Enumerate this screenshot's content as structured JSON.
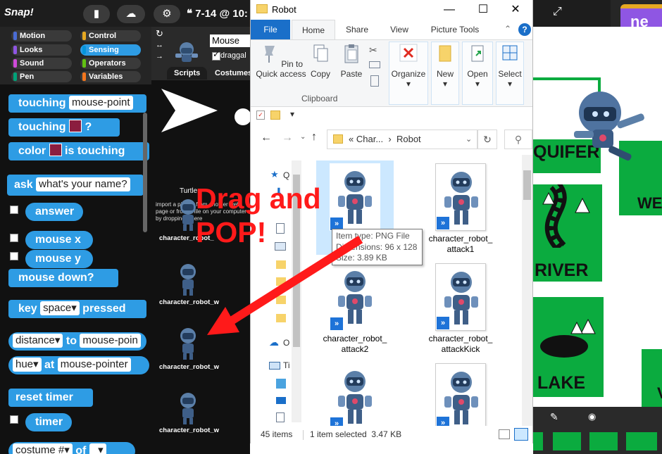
{
  "snap": {
    "logo": "Snap!",
    "project_title": "7-14 @ 10:",
    "categories": [
      {
        "label": "Motion",
        "color": "#4a6cd4"
      },
      {
        "label": "Looks",
        "color": "#8f56e3"
      },
      {
        "label": "Sound",
        "color": "#cf4ad9"
      },
      {
        "label": "Pen",
        "color": "#00a178"
      },
      {
        "label": "Control",
        "color": "#e6a822"
      },
      {
        "label": "Sensing",
        "color": "#0494dc"
      },
      {
        "label": "Operators",
        "color": "#62c213"
      },
      {
        "label": "Variables",
        "color": "#f3761d"
      }
    ],
    "blocks": {
      "touching_label": "touching",
      "touching_mouse_value": "mouse-point",
      "touching_color_label": "touching",
      "touching_color_q": "?",
      "color_label": "color",
      "is_touching_label": "is touching",
      "ask_label": "ask",
      "ask_default": "what's your name?",
      "answer": "answer",
      "mouse_x": "mouse x",
      "mouse_y": "mouse y",
      "mouse_down": "mouse down?",
      "key_label": "key",
      "key_value": "space",
      "pressed_label": "pressed",
      "distance_drop": "distance",
      "to_label": "to",
      "distance_target": "mouse-poin",
      "hue_drop": "hue",
      "at_label": "at",
      "at_target": "mouse-pointer",
      "reset_timer": "reset timer",
      "timer": "timer",
      "costume_drop": "costume #",
      "of_label": "of"
    },
    "sprite": {
      "name": "Mouse",
      "draggable_label": "draggal",
      "tabs": [
        "Scripts",
        "Costumes"
      ]
    },
    "costumes": {
      "turtle_label": "Turtle",
      "import_hint": "import a picture from another web page or from a file on your computer by dropping it here",
      "items": [
        "character_robot_",
        "character_robot_w",
        "character_robot_w",
        "character_robot_w"
      ]
    }
  },
  "explorer": {
    "title": "Robot",
    "ribbon_tabs": [
      "File",
      "Home",
      "Share",
      "View",
      "Picture Tools"
    ],
    "ribbon_buttons": {
      "pin": "Pin to Quick access",
      "copy": "Copy",
      "paste": "Paste",
      "organize": "Organize",
      "new": "New",
      "open": "Open",
      "select": "Select"
    },
    "clipboard_group": "Clipboard",
    "address": {
      "prefix": "«",
      "crumb1": "Char...",
      "sep": "›",
      "crumb2": "Robot"
    },
    "nav_labels": [
      "Q",
      "O",
      "Ti"
    ],
    "files": [
      {
        "name": ""
      },
      {
        "name": "character_robot_ attack1"
      },
      {
        "name": "character_robot_ attack2"
      },
      {
        "name": "character_robot_ attackKick"
      },
      {
        "name": ""
      },
      {
        "name": ""
      }
    ],
    "tooltip": {
      "type": "Item type: PNG File",
      "dimensions": "Dimensions: 96 x 128",
      "size": "Size: 3.89 KB"
    },
    "status": {
      "count": "45 items",
      "selected": "1 item selected  3.47 KB"
    }
  },
  "stage": {
    "cards": [
      "QUIFER",
      "WE",
      "RIVER",
      "LAKE",
      "V"
    ],
    "corner_block": "ne"
  },
  "annotation": {
    "text_line1": "Drag and",
    "text_line2": "POP!",
    "color": "#ff1a1a"
  }
}
